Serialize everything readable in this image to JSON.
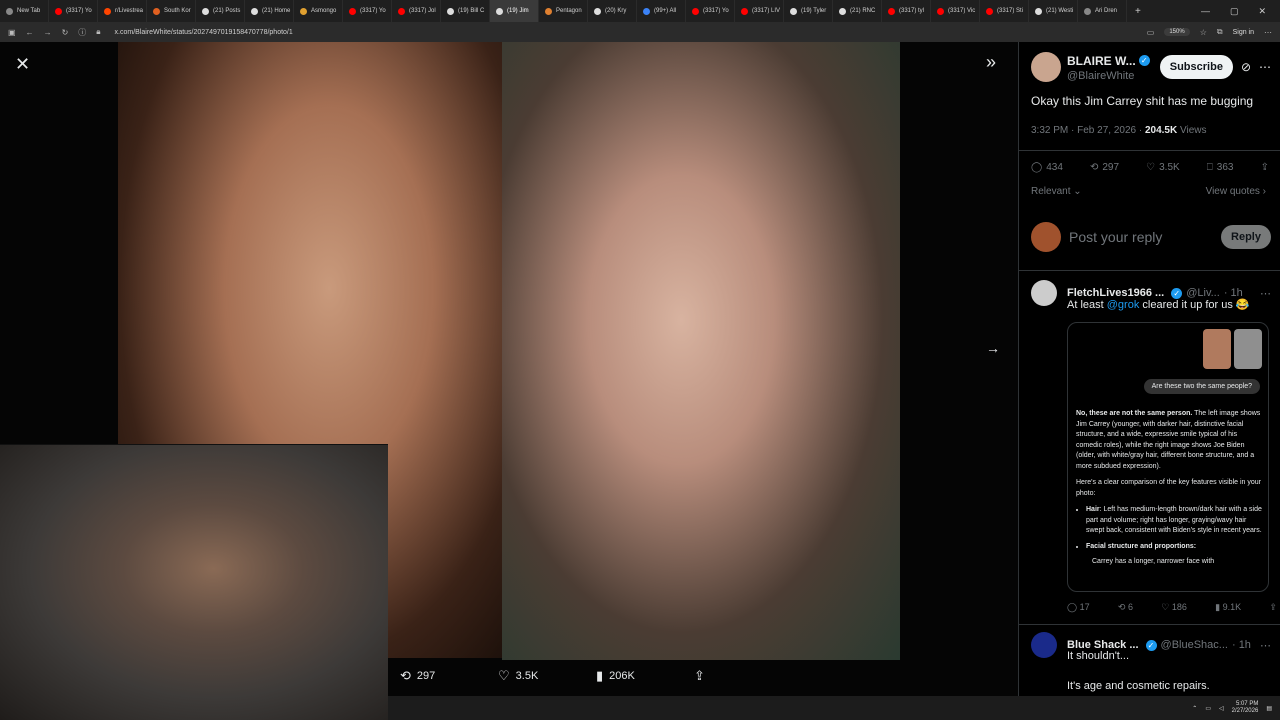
{
  "browser": {
    "tabs": [
      {
        "label": "New Tab",
        "color": "#888888"
      },
      {
        "label": "(3317) Yo",
        "color": "#ff0000"
      },
      {
        "label": "r/Livestrea",
        "color": "#ff4500"
      },
      {
        "label": "South Kor",
        "color": "#e06020"
      },
      {
        "label": "(21) Posts",
        "color": "#dddddd"
      },
      {
        "label": "(21) Home",
        "color": "#dddddd"
      },
      {
        "label": "Asmongo",
        "color": "#e0a030"
      },
      {
        "label": "(3317) Yo",
        "color": "#ff0000"
      },
      {
        "label": "(3317) Jol",
        "color": "#ff0000"
      },
      {
        "label": "(19) Bill C",
        "color": "#dddddd"
      },
      {
        "label": "(19) Jim",
        "color": "#dddddd"
      },
      {
        "label": "Pentagon",
        "color": "#e08030"
      },
      {
        "label": "(20) Kry",
        "color": "#dddddd"
      },
      {
        "label": "(99+) All",
        "color": "#3b82f6"
      },
      {
        "label": "(3317) Yo",
        "color": "#ff0000"
      },
      {
        "label": "(3317) LIV",
        "color": "#ff0000"
      },
      {
        "label": "(19) Tyler",
        "color": "#dddddd"
      },
      {
        "label": "(21) RNC",
        "color": "#dddddd"
      },
      {
        "label": "(3317) tyl",
        "color": "#ff0000"
      },
      {
        "label": "(3317) Vic",
        "color": "#ff0000"
      },
      {
        "label": "(3317) Sti",
        "color": "#ff0000"
      },
      {
        "label": "(21) Westi",
        "color": "#dddddd"
      },
      {
        "label": "Ari Dren",
        "color": "#888888"
      }
    ],
    "active_tab_index": 10,
    "new_tab": "+",
    "url": "x.com/BlaireWhite/status/2027497019158470778/photo/1",
    "zoom": "150%",
    "sign_in": "Sign in"
  },
  "viewer": {
    "close": "✕",
    "expand": "»",
    "next": "→",
    "left_photo_alt": "Jim Carrey younger photo",
    "right_photo_alt": "Jim Carrey recent photo",
    "actions": {
      "retweets": "297",
      "likes": "3.5K",
      "views": "206K"
    }
  },
  "panel": {
    "author": {
      "name": "BLAIRE W...",
      "handle": "@BlaireWhite",
      "subscribe": "Subscribe",
      "avatar_color": "#c9a58f"
    },
    "tweet": {
      "text": "Okay this Jim Carrey shit has me bugging",
      "time": "3:32 PM · Feb 27, 2026 · ",
      "views_count": "204.5K",
      "views_label": " Views"
    },
    "stats": {
      "replies": "434",
      "retweets": "297",
      "likes": "3.5K",
      "bookmarks": "363"
    },
    "sort": "Relevant",
    "view_quotes": "View quotes",
    "reply_placeholder": "Post your reply",
    "reply_button": "Reply",
    "replies": [
      {
        "name": "FletchLives1966 ...",
        "handle": "@Liv...",
        "time": "· 1h",
        "text_prefix": "At least ",
        "mention": "@grok",
        "text_suffix": " cleared it up for us 😂",
        "stats": {
          "replies": "17",
          "retweets": "6",
          "likes": "186",
          "views": "9.1K"
        }
      },
      {
        "name": "Blue Shack ...",
        "handle": "@BlueShac...",
        "time": "· 1h",
        "text": "It shouldn't...",
        "text2": "It's age and cosmetic repairs."
      }
    ],
    "grok_card": {
      "question": "Are these two the same people?",
      "answer_lead": "No, these are not the same person.",
      "answer_body": " The left image shows Jim Carrey (younger, with darker hair, distinctive facial structure, and a wide, expressive smile typical of his comedic roles), while the right image shows Joe Biden (older, with white/gray hair, different bone structure, and a more subdued expression).",
      "comparison_intro": "Here's a clear comparison of the key features visible in your photo:",
      "hair_label": "Hair",
      "hair_text": ": Left has medium-length brown/dark hair with a side part and volume; right has longer, graying/wavy hair swept back, consistent with Biden's style in recent years.",
      "facial_label": "Facial structure and proportions:",
      "cutoff_text": "Carrey has a longer, narrower face with"
    }
  },
  "taskbar": {
    "time": "5:07 PM",
    "date": "2/27/2026"
  }
}
